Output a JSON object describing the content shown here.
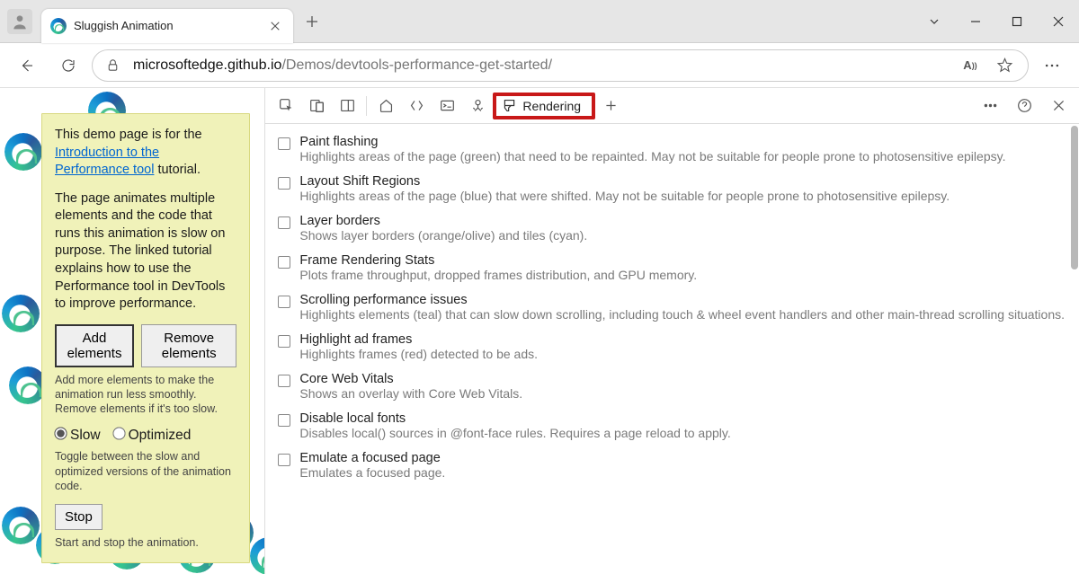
{
  "browser": {
    "tab_title": "Sluggish Animation",
    "url_prefix": "microsoftedge.github.io",
    "url_path": "/Demos/devtools-performance-get-started/"
  },
  "page": {
    "intro_pre": "This demo page is for the ",
    "intro_link": "Introduction to the Performance tool",
    "intro_post": " tutorial.",
    "para2": "The page animates multiple elements and the code that runs this animation is slow on purpose. The linked tutorial explains how to use the Performance tool in DevTools to improve performance.",
    "btn_add": "Add elements",
    "btn_remove": "Remove elements",
    "hint_add_remove": "Add more elements to make the animation run less smoothly. Remove elements if it's too slow.",
    "radio_slow": "Slow",
    "radio_optimized": "Optimized",
    "hint_toggle": "Toggle between the slow and optimized versions of the animation code.",
    "btn_stop": "Stop",
    "hint_stop": "Start and stop the animation."
  },
  "devtools": {
    "active_tab": "Rendering",
    "options": [
      {
        "title": "Paint flashing",
        "desc": "Highlights areas of the page (green) that need to be repainted. May not be suitable for people prone to photosensitive epilepsy."
      },
      {
        "title": "Layout Shift Regions",
        "desc": "Highlights areas of the page (blue) that were shifted. May not be suitable for people prone to photosensitive epilepsy."
      },
      {
        "title": "Layer borders",
        "desc": "Shows layer borders (orange/olive) and tiles (cyan)."
      },
      {
        "title": "Frame Rendering Stats",
        "desc": "Plots frame throughput, dropped frames distribution, and GPU memory."
      },
      {
        "title": "Scrolling performance issues",
        "desc": "Highlights elements (teal) that can slow down scrolling, including touch & wheel event handlers and other main-thread scrolling situations."
      },
      {
        "title": "Highlight ad frames",
        "desc": "Highlights frames (red) detected to be ads."
      },
      {
        "title": "Core Web Vitals",
        "desc": "Shows an overlay with Core Web Vitals."
      },
      {
        "title": "Disable local fonts",
        "desc": "Disables local() sources in @font-face rules. Requires a page reload to apply."
      },
      {
        "title": "Emulate a focused page",
        "desc": "Emulates a focused page."
      }
    ]
  }
}
